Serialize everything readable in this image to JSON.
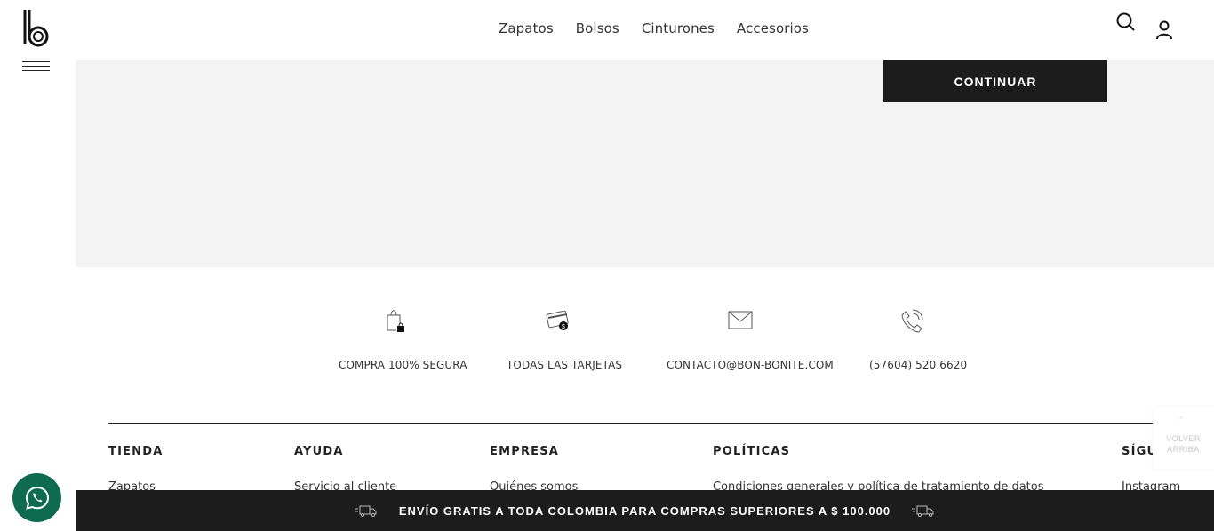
{
  "nav": {
    "links": [
      "Zapatos",
      "Bolsos",
      "Cinturones",
      "Accesorios"
    ]
  },
  "panel": {
    "continue_label": "CONTINUAR"
  },
  "features": [
    {
      "icon": "shopping-bag-lock-icon",
      "label": "COMPRA 100% SEGURA"
    },
    {
      "icon": "credit-card-icon",
      "label": "TODAS LAS TARJETAS"
    },
    {
      "icon": "envelope-icon",
      "label": "CONTACTO@BON-BONITE.COM"
    },
    {
      "icon": "phone-icon",
      "label": "(57604) 520 6620"
    }
  ],
  "footer": {
    "columns": [
      {
        "title": "TIENDA",
        "first_link": "Zapatos"
      },
      {
        "title": "AYUDA",
        "first_link": "Servicio al cliente"
      },
      {
        "title": "EMPRESA",
        "first_link": "Quiénes somos"
      },
      {
        "title": "POLÍTICAS",
        "first_link": "Condiciones generales y política de tratamiento de datos"
      },
      {
        "title": "SÍGUENOS",
        "first_link": "Instagram"
      }
    ]
  },
  "back_to_top": {
    "line1": "VOLVER",
    "line2": "ARRIBA"
  },
  "shipping_bar": {
    "text": "ENVÍO GRATIS A TODA COLOMBIA PARA COMPRAS SUPERIORES A $ 100.000"
  },
  "colors": {
    "dark": "#1c1c1c",
    "panel": "#f3f3f3",
    "whatsapp": "#0f6b4f"
  }
}
